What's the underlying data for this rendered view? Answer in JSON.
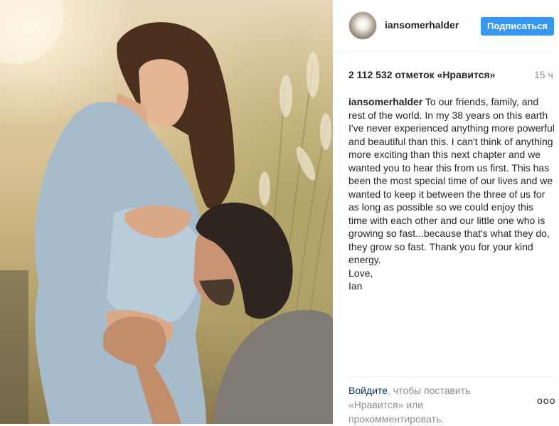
{
  "post": {
    "username": "iansomerhalder",
    "follow_label": "Подписаться",
    "likes": "2 112 532 отметок «Нравится»",
    "time": "15 ч",
    "caption_user": "iansomerhalder",
    "caption_text": " To our friends, family, and rest of the world. In my 38 years on this earth I've never experienced anything more powerful and beautiful than this. I can't think of anything more exciting than this next chapter and we wanted you to hear this from us first. This has been the most special time of our lives and we wanted to keep it between the three of us for as long as possible so we could enjoy this time with each other and our little one who is growing so fast...because that's what they do, they grow so fast. Thank you for your kind energy.\nLove,\nIan",
    "login_link": "Войдите",
    "login_rest": ", чтобы поставить «Нравится» или прокомментировать.",
    "more_icon": "ooo"
  },
  "colors": {
    "follow_button": "#3897f0",
    "link": "#003569",
    "muted": "#8e8e8e",
    "text": "#262626"
  },
  "icons": [
    "avatar-image",
    "more-options-icon"
  ]
}
